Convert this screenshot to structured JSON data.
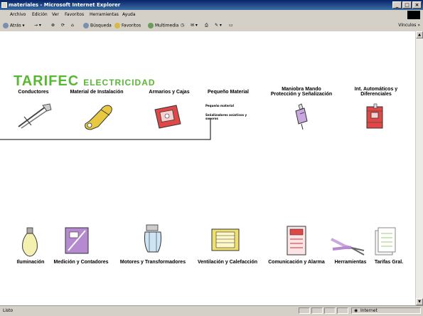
{
  "window": {
    "title": "materiales - Microsoft Internet Explorer"
  },
  "menu": [
    "Archivo",
    "Edición",
    "Ver",
    "Favoritos",
    "Herramientas",
    "Ayuda"
  ],
  "toolbar": {
    "back": "Atrás",
    "search": "Búsqueda",
    "favorites": "Favoritos",
    "multimedia": "Multimedia",
    "links": "Vínculos »"
  },
  "brand": {
    "name": "TARIFEC",
    "tagline": "ELECTRICIDAD"
  },
  "top_categories": [
    {
      "label": "Conductores"
    },
    {
      "label": "Material de Instalación"
    },
    {
      "label": "Armarios y Cajas"
    },
    {
      "label": "Pequeño Material"
    },
    {
      "label": "Maniobra Mando",
      "label2": "Protección y Señalización"
    },
    {
      "label": "Int. Automáticos y",
      "label2": "Diferenciales"
    }
  ],
  "submenu": {
    "item1": "Pequeño material",
    "item2": "Señalizadores acústicos y",
    "item2b": "sonoros"
  },
  "bottom_categories": [
    {
      "label": "Iluminación"
    },
    {
      "label": "Medición y Contadores"
    },
    {
      "label": "Motores y Transformadores"
    },
    {
      "label": "Ventilación y Calefacción"
    },
    {
      "label": "Comunicación y Alarma"
    },
    {
      "label": "Herramientas"
    },
    {
      "label": "Tarifas Gral."
    }
  ],
  "status": {
    "text": "Listo",
    "zone": "Internet"
  },
  "colors": {
    "brand": "#5ab735",
    "titlebar": "#0a246a",
    "chrome": "#d4d0c8"
  }
}
